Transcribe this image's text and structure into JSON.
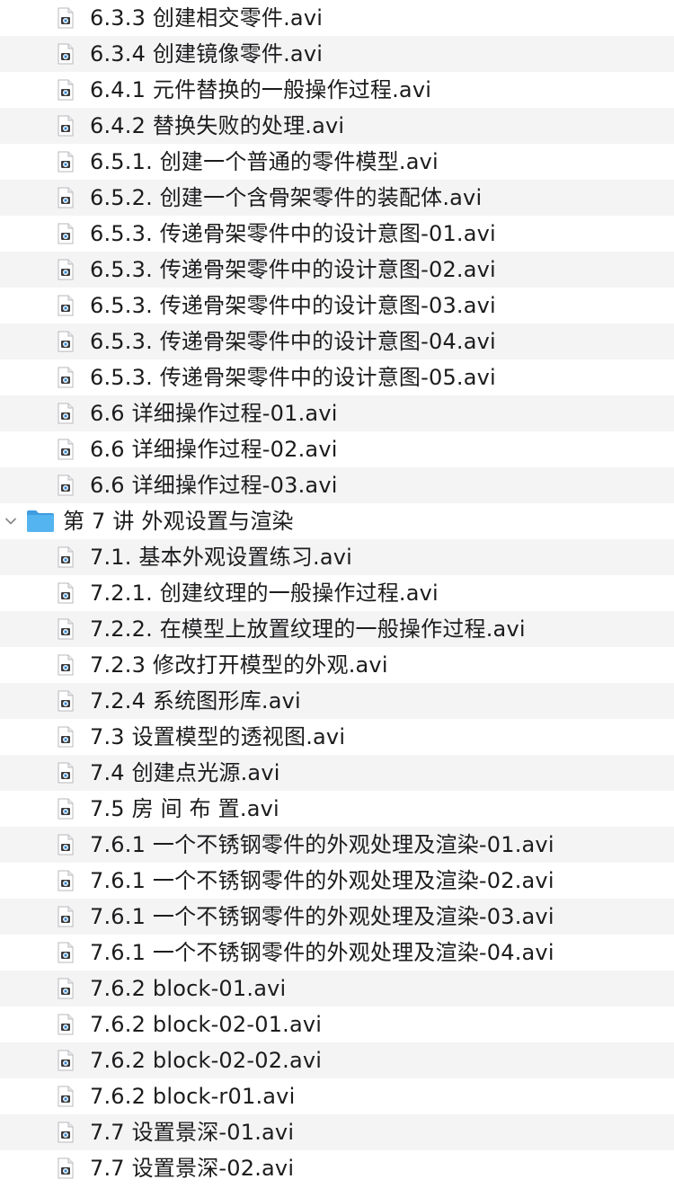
{
  "file_list": {
    "items": [
      {
        "kind": "file",
        "label": "6.3.3  创建相交零件.avi"
      },
      {
        "kind": "file",
        "label": "6.3.4  创建镜像零件.avi"
      },
      {
        "kind": "file",
        "label": "6.4.1  元件替换的一般操作过程.avi"
      },
      {
        "kind": "file",
        "label": "6.4.2  替换失败的处理.avi"
      },
      {
        "kind": "file",
        "label": "6.5.1.  创建一个普通的零件模型.avi"
      },
      {
        "kind": "file",
        "label": "6.5.2.  创建一个含骨架零件的装配体.avi"
      },
      {
        "kind": "file",
        "label": "6.5.3.  传递骨架零件中的设计意图-01.avi"
      },
      {
        "kind": "file",
        "label": "6.5.3.  传递骨架零件中的设计意图-02.avi"
      },
      {
        "kind": "file",
        "label": "6.5.3.  传递骨架零件中的设计意图-03.avi"
      },
      {
        "kind": "file",
        "label": "6.5.3.  传递骨架零件中的设计意图-04.avi"
      },
      {
        "kind": "file",
        "label": "6.5.3.  传递骨架零件中的设计意图-05.avi"
      },
      {
        "kind": "file",
        "label": "6.6  详细操作过程-01.avi"
      },
      {
        "kind": "file",
        "label": "6.6  详细操作过程-02.avi"
      },
      {
        "kind": "file",
        "label": "6.6  详细操作过程-03.avi"
      },
      {
        "kind": "folder",
        "label": "第 7 讲  外观设置与渲染",
        "expanded": true
      },
      {
        "kind": "file",
        "label": "7.1.  基本外观设置练习.avi"
      },
      {
        "kind": "file",
        "label": "7.2.1.  创建纹理的一般操作过程.avi"
      },
      {
        "kind": "file",
        "label": "7.2.2.  在模型上放置纹理的一般操作过程.avi"
      },
      {
        "kind": "file",
        "label": "7.2.3  修改打开模型的外观.avi"
      },
      {
        "kind": "file",
        "label": "7.2.4  系统图形库.avi"
      },
      {
        "kind": "file",
        "label": "7.3  设置模型的透视图.avi"
      },
      {
        "kind": "file",
        "label": "7.4  创建点光源.avi"
      },
      {
        "kind": "file",
        "label": "7.5  房 间 布 置.avi"
      },
      {
        "kind": "file",
        "label": "7.6.1  一个不锈钢零件的外观处理及渲染-01.avi"
      },
      {
        "kind": "file",
        "label": "7.6.1  一个不锈钢零件的外观处理及渲染-02.avi"
      },
      {
        "kind": "file",
        "label": "7.6.1  一个不锈钢零件的外观处理及渲染-03.avi"
      },
      {
        "kind": "file",
        "label": "7.6.1  一个不锈钢零件的外观处理及渲染-04.avi"
      },
      {
        "kind": "file",
        "label": "7.6.2 block-01.avi"
      },
      {
        "kind": "file",
        "label": "7.6.2 block-02-01.avi"
      },
      {
        "kind": "file",
        "label": "7.6.2 block-02-02.avi"
      },
      {
        "kind": "file",
        "label": "7.6.2 block-r01.avi"
      },
      {
        "kind": "file",
        "label": "7.7 设置景深-01.avi"
      },
      {
        "kind": "file",
        "label": "7.7 设置景深-02.avi"
      }
    ]
  },
  "icons": {
    "file": "video-file-icon",
    "folder": "folder-icon",
    "disclosure": "chevron-down-icon"
  },
  "colors": {
    "row_stripe": "#f4f4f5",
    "text": "#1c1c1e",
    "folder_blue": "#54b4ef"
  }
}
